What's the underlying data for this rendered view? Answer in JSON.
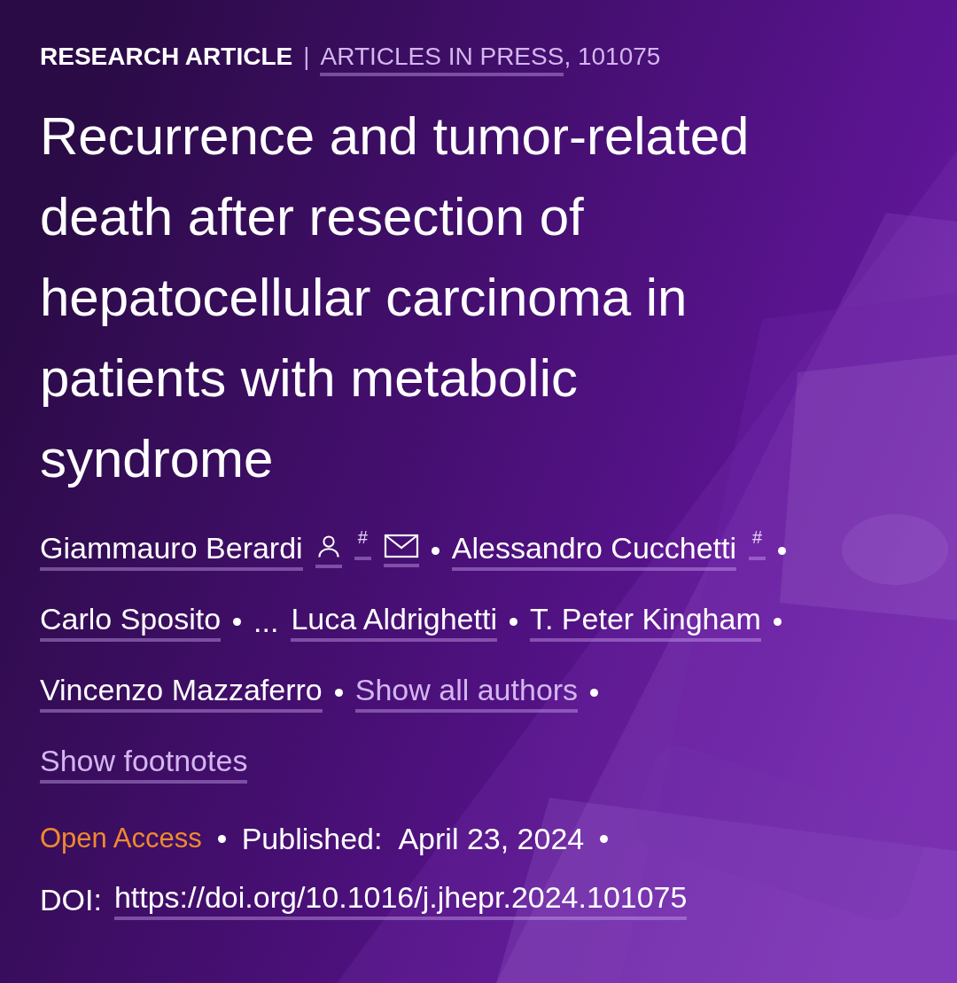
{
  "header": {
    "type": "RESEARCH ARTICLE",
    "divider": "|",
    "issue_link": "ARTICLES IN PRESS",
    "issue_number": ", 101075"
  },
  "title": "Recurrence and tumor-related death after resection of hepatocellular carcinoma in patients with metabolic syndrome",
  "author_rows": [
    {
      "items": [
        {
          "kind": "author",
          "name": "Giammauro Berardi",
          "corresponding": true,
          "footnote": "#",
          "email": true
        },
        {
          "kind": "author",
          "name": "Alessandro Cucchetti",
          "corresponding": false,
          "footnote": "#",
          "email": false
        }
      ]
    },
    {
      "items": [
        {
          "kind": "author",
          "name": "Carlo Sposito",
          "corresponding": false,
          "email": false
        },
        {
          "kind": "ellipsis",
          "text": "..."
        },
        {
          "kind": "author",
          "name": "Luca Aldrighetti",
          "corresponding": false,
          "email": false
        },
        {
          "kind": "author",
          "name": "T. Peter Kingham",
          "corresponding": false,
          "email": false
        }
      ]
    },
    {
      "items": [
        {
          "kind": "author",
          "name": "Vincenzo Mazzaferro",
          "corresponding": false,
          "email": false
        },
        {
          "kind": "toggle",
          "text": "Show all authors"
        }
      ]
    },
    {
      "items": [
        {
          "kind": "toggle",
          "text": "Show footnotes"
        }
      ]
    }
  ],
  "access": "Open Access",
  "published_label": "Published:",
  "published_date": "April 23, 2024",
  "doi_label": "DOI:",
  "doi": "https://doi.org/10.1016/j.jhepr.2024.101075"
}
